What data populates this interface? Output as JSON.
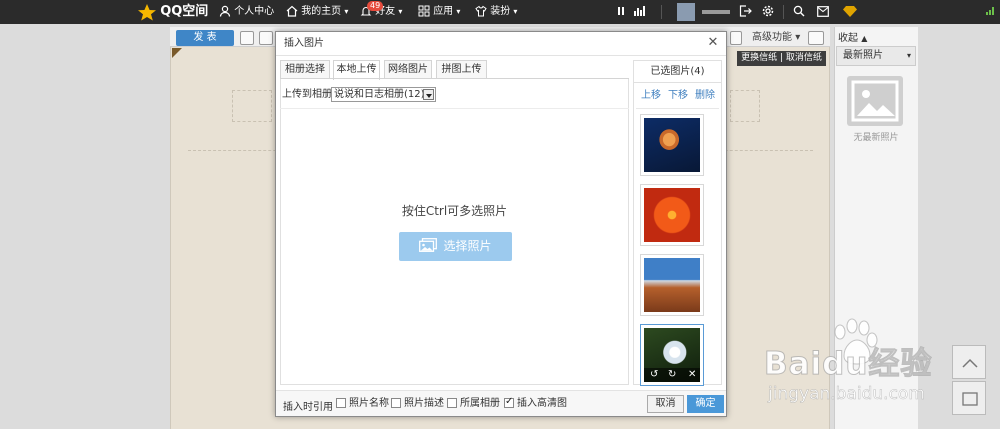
{
  "topbar": {
    "logo": "QQ空间",
    "profile": "个人中心",
    "home": "我的主页",
    "friends": "好友",
    "friends_badge": "49",
    "apps": "应用",
    "decorate": "装扮"
  },
  "editor": {
    "publish": "发 表",
    "advanced": "高级功能",
    "wallpaper": "更换信纸 | 取消信纸"
  },
  "sidebar": {
    "collapse": "收起",
    "recent": "最新照片",
    "no_photo": "无最新照片"
  },
  "watermark": {
    "brand": "Baidu经验",
    "url": "jingyan.baidu.com"
  },
  "dialog": {
    "title": "插入图片",
    "tabs": [
      "相册选择",
      "本地上传",
      "网络图片",
      "拼图上传"
    ],
    "active_tab": "本地上传",
    "upload_to_label": "上传到相册",
    "album_value": "说说和日志相册(12)",
    "hint": "按住Ctrl可多选照片",
    "choose_button": "选择照片",
    "selected_header": "已选图片(4)",
    "actions": {
      "up": "上移",
      "down": "下移",
      "delete": "删除"
    },
    "thumbnails": [
      {
        "subject": "jellyfish",
        "colors": [
          "#0a1f4a",
          "#c9692a"
        ]
      },
      {
        "subject": "red flower",
        "colors": [
          "#c12a10",
          "#f25a18"
        ]
      },
      {
        "subject": "desert mesa",
        "colors": [
          "#3f7fc7",
          "#a55a2a"
        ]
      },
      {
        "subject": "white flowers",
        "colors": [
          "#1e3a16",
          "#e8ecf0"
        ]
      }
    ],
    "footer": {
      "quote_label": "插入时引用",
      "options": [
        {
          "label": "照片名称",
          "checked": false
        },
        {
          "label": "照片描述",
          "checked": false
        },
        {
          "label": "所属相册",
          "checked": false
        },
        {
          "label": "插入高清图",
          "checked": true
        }
      ],
      "cancel": "取消",
      "ok": "确定"
    }
  },
  "colors": {
    "topbar_bg": "#2b2b2b",
    "primary_button": "#4a98d8",
    "choose_button": "#9ccaee",
    "link": "#3f7fbf"
  }
}
